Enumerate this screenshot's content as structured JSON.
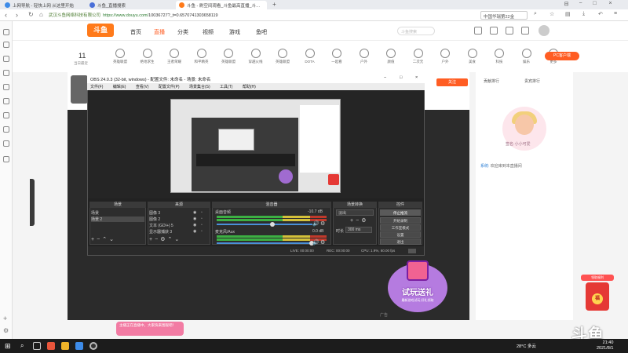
{
  "browser": {
    "tabs": [
      {
        "label": "上网导航 - 轻快上网 从这里开始",
        "icon_color": "#3d8be8"
      },
      {
        "label": "斗鱼_直播搜索",
        "icon_color": "#4a6fd8"
      },
      {
        "label": "斗鱼 - 刷空间观看_斗鱼最高直播_斗…",
        "icon_color": "#ff7a1a"
      }
    ],
    "window_controls": [
      "⊟",
      "−",
      "□",
      "×"
    ],
    "site_owner": "武汉斗鱼网络科技有限公司",
    "url_domain": "https://www.douyu.com/",
    "url_path": "10036727?_t=0.6570741303658119",
    "right_search": "中国华瑞第22金"
  },
  "douyu": {
    "logo": "斗鱼",
    "nav": [
      "首页",
      "直播",
      "分类",
      "视频",
      "游戏",
      "鱼吧"
    ],
    "nav_active": "直播",
    "header_search": "斗鱼搜索",
    "categories": [
      "英雄联盟",
      "绝地求生",
      "王者荣耀",
      "和平精英",
      "英雄联盟",
      "穿越火线",
      "英雄联盟",
      "DOTA",
      "一起看",
      "户外",
      "颜值",
      "二次元",
      "户外",
      "美食",
      "科技",
      "娱乐",
      "更多"
    ],
    "count": "11",
    "count_label": "当日最近",
    "pc_client": "PC客户端",
    "follow": "关注",
    "rank_tab_1": "贡献排行",
    "rank_tab_2": "贵宾排行",
    "anchor_sign": "签名·小小可爱",
    "chat": {
      "user": "系统:",
      "message": "欢迎来到本直播间"
    },
    "ad_label": "广告",
    "promo_title": "试玩送礼",
    "promo_sub": "最新游戏试玩 好礼领取",
    "pink_bubble": "主播正在直播中，大家快来围观吧！",
    "redpack_cap": "领取福利",
    "redpack_coin": "福",
    "watermark": "斗鱼"
  },
  "obs": {
    "title": "OBS 24.0.3 (32-bit, windows) - 配置文件: 未命名 - 场景: 未命名",
    "menu": [
      "文件(F)",
      "编辑(E)",
      "查看(V)",
      "配置文件(P)",
      "场景集合(S)",
      "工具(T)",
      "帮助(H)"
    ],
    "docks": {
      "scenes": "场景",
      "sources": "来源",
      "mixer": "混音器",
      "transitions": "场景转换",
      "controls": "控件"
    },
    "scenes": [
      "场景",
      "场景 2"
    ],
    "sources": [
      "图像 3",
      "图像 2",
      "文本 (GDI+) 5",
      "显示器捕获 3"
    ],
    "mixer": [
      {
        "name": "桌面音频",
        "db": "-10.7 dB"
      },
      {
        "name": "麦克风/Aux",
        "db": "0.0 dB"
      }
    ],
    "transition": "淡出",
    "duration_label": "时长",
    "duration": "300 ms",
    "controls": [
      "停止推流",
      "开始录制",
      "工作室模式",
      "设置",
      "退出"
    ],
    "status": {
      "live": "LIVE: 00:00:00",
      "rec": "REC: 00:00:00",
      "cpu": "CPU: 1.9%, 60.00 fps"
    }
  },
  "taskbar": {
    "weather": "28°C 多云",
    "time": "21:40",
    "date": "2021/8/1"
  }
}
